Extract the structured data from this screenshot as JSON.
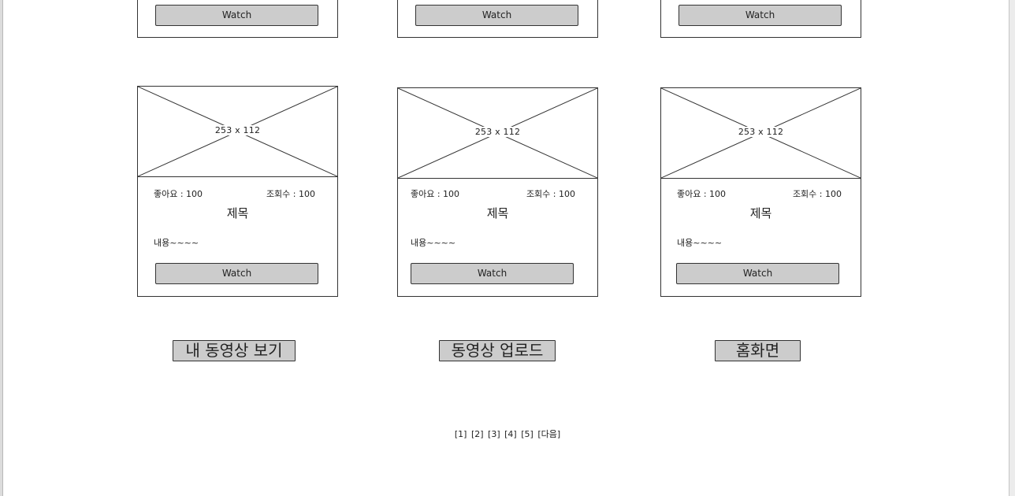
{
  "cards_top": [
    {
      "watch_label": "Watch"
    },
    {
      "watch_label": "Watch"
    },
    {
      "watch_label": "Watch"
    }
  ],
  "cards": [
    {
      "thumb_label": "253 x 112",
      "likes": "좋아요 : 100",
      "views": "조회수 : 100",
      "title": "제목",
      "content": "내용~~~~",
      "watch_label": "Watch"
    },
    {
      "thumb_label": "253 x 112",
      "likes": "좋아요 : 100",
      "views": "조회수 : 100",
      "title": "제목",
      "content": "내용~~~~",
      "watch_label": "Watch"
    },
    {
      "thumb_label": "253 x 112",
      "likes": "좋아요 : 100",
      "views": "조회수 : 100",
      "title": "제목",
      "content": "내용~~~~",
      "watch_label": "Watch"
    }
  ],
  "actions": {
    "my_videos": "내 동영상 보기",
    "upload": "동영상 업로드",
    "home": "홈화면"
  },
  "pagination": {
    "pages": [
      "[1]",
      "[2]",
      "[3]",
      "[4]",
      "[5]"
    ],
    "next": "[다음]"
  }
}
